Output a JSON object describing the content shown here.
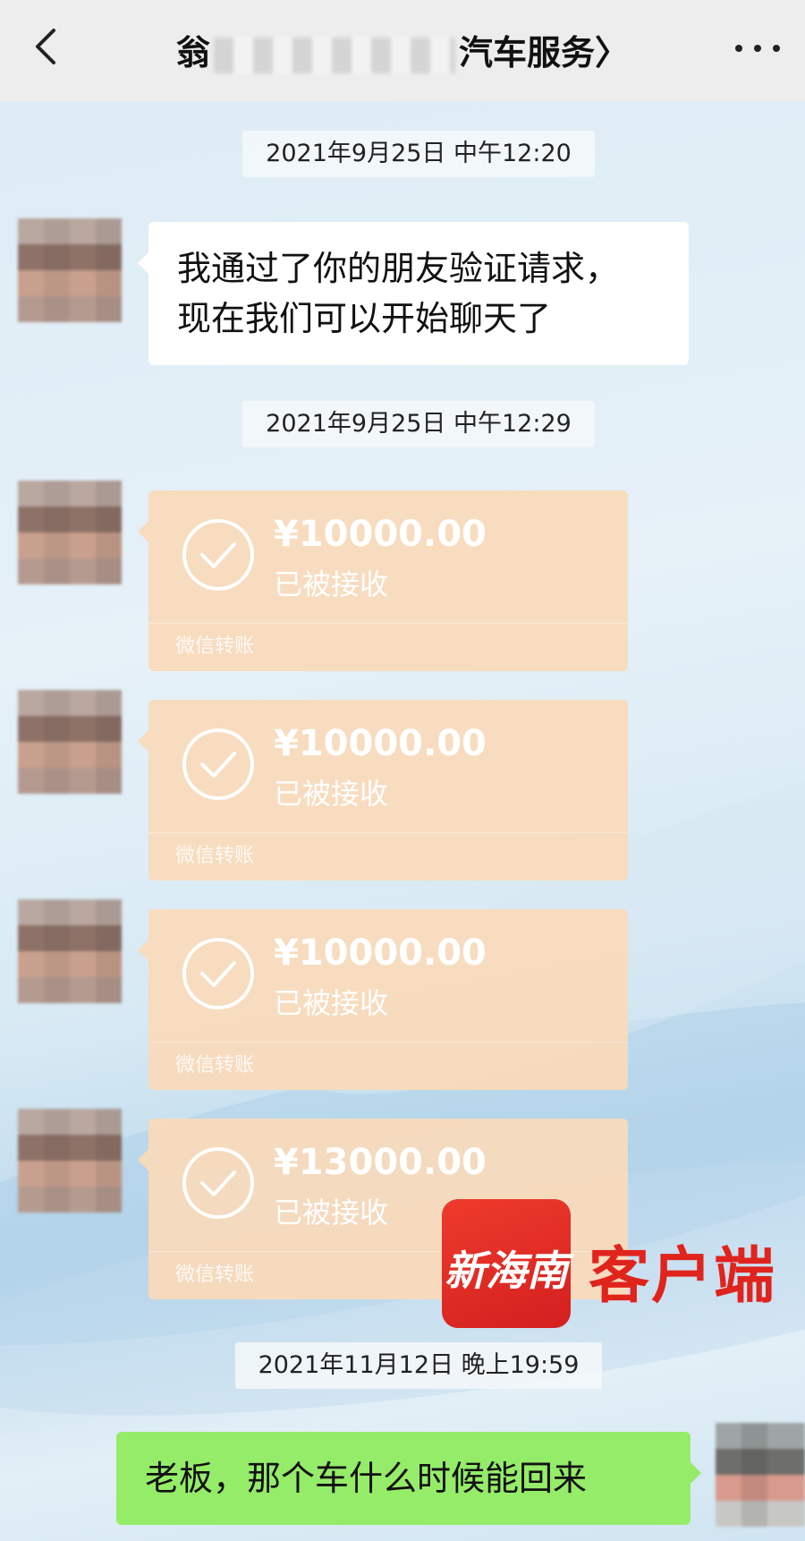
{
  "header": {
    "title_prefix": "翁",
    "title_suffix": "汽车服务〉",
    "back_icon": "chevron-left-icon",
    "more_icon": "more-dots-icon"
  },
  "messages": {
    "ts1": "2021年9月25日 中午12:20",
    "text1_line1": "我通过了你的朋友验证请求，",
    "text1_line2": "现在我们可以开始聊天了",
    "ts2": "2021年9月25日 中午12:29",
    "transfers": [
      {
        "amount": "¥10000.00",
        "status": "已被接收",
        "caption": "微信转账"
      },
      {
        "amount": "¥10000.00",
        "status": "已被接收",
        "caption": "微信转账"
      },
      {
        "amount": "¥10000.00",
        "status": "已被接收",
        "caption": "微信转账"
      },
      {
        "amount": "¥13000.00",
        "status": "已被接收",
        "caption": "微信转账"
      }
    ],
    "ts3": "2021年11月12日 晚上19:59",
    "text2": "老板，那个车什么时候能回来"
  },
  "watermark": {
    "logo_text": "新海南",
    "label": "客户端",
    "color": "#e0241d"
  },
  "colors": {
    "header_bg": "#ededed",
    "self_bubble": "#95ec69",
    "transfer_card": "#fadaba"
  }
}
